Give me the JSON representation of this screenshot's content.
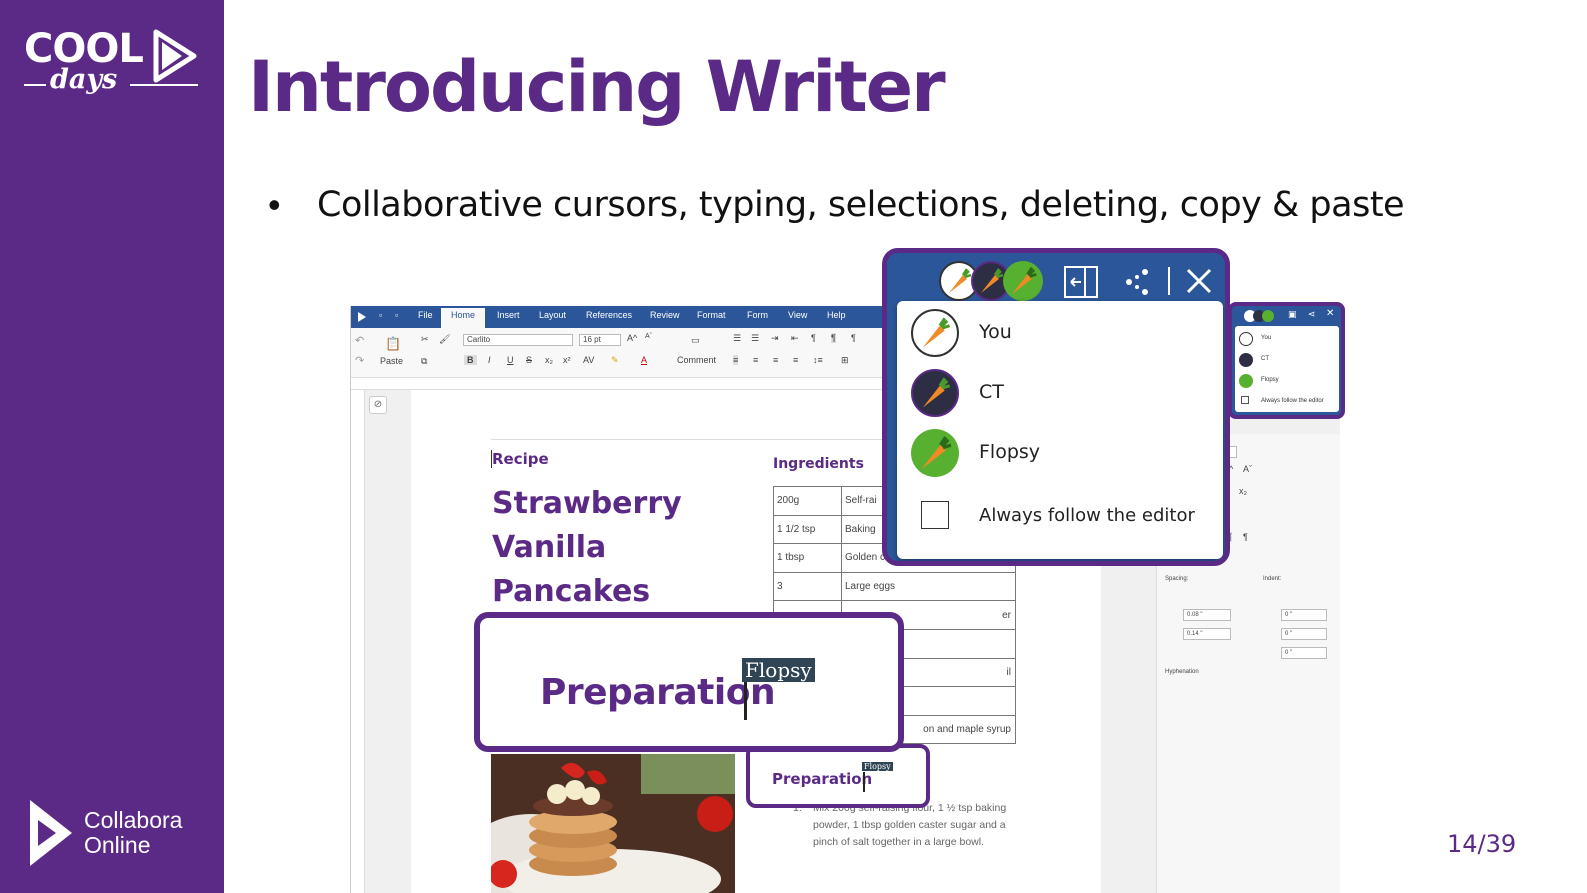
{
  "slide": {
    "title": "Introducing Writer",
    "bullet": "Collaborative cursors, typing, selections, deleting, copy & paste",
    "page_number": "14/39"
  },
  "branding": {
    "cool_word": "COOL",
    "days_word": "days",
    "collabora_line1": "Collabora",
    "collabora_line2": "Online",
    "brand_color": "#5b2a86"
  },
  "writer": {
    "menu": [
      "File",
      "Home",
      "Insert",
      "Layout",
      "References",
      "Review",
      "Format",
      "Form",
      "View",
      "Help"
    ],
    "active_menu": "Home",
    "ribbon": {
      "paste_label": "Paste",
      "font_name": "Carlito",
      "font_size": "16 pt",
      "comment_label": "Comment",
      "side_font_size": "16 pt",
      "spacing_label": "Spacing:",
      "indent_label": "Indent:",
      "spacing_above": "0.08 \"",
      "spacing_below": "0.14 \"",
      "indent_values": [
        "0 \"",
        "0 \"",
        "0 \""
      ],
      "hyphenation_label": "Hyphenation"
    },
    "document": {
      "recipe_label": "Recipe",
      "heading_lines": [
        "Strawberry",
        "Vanilla",
        "Pancakes"
      ],
      "ingredients_label": "Ingredients",
      "ingredients": [
        [
          "200g",
          "Self-rai"
        ],
        [
          "1 1/2 tsp",
          "Baking"
        ],
        [
          "1 tbsp",
          "Golden c"
        ],
        [
          "3",
          "Large eggs"
        ],
        [
          "",
          "er"
        ],
        [
          "",
          ""
        ],
        [
          "",
          "il"
        ],
        [
          "",
          ""
        ],
        [
          "",
          "on and maple syrup"
        ]
      ],
      "step_number": "1.",
      "step_text": "Mix 200g self-raising flour, 1 ½ tsp baking powder, 1 tbsp golden caster sugar and a pinch of salt together in a large bowl."
    },
    "preparation_heading": "Preparation",
    "cursor_owner_label": "Flopsy"
  },
  "collaborators": {
    "users": [
      {
        "name": "You",
        "avatar_color": "#ffffff",
        "icon": "carrot-icon"
      },
      {
        "name": "CT",
        "avatar_color": "#2d2d44",
        "icon": "carrot-icon"
      },
      {
        "name": "Flopsy",
        "avatar_color": "#58b030",
        "icon": "carrot-icon"
      }
    ],
    "follow_label": "Always follow the editor",
    "follow_checked": false
  }
}
